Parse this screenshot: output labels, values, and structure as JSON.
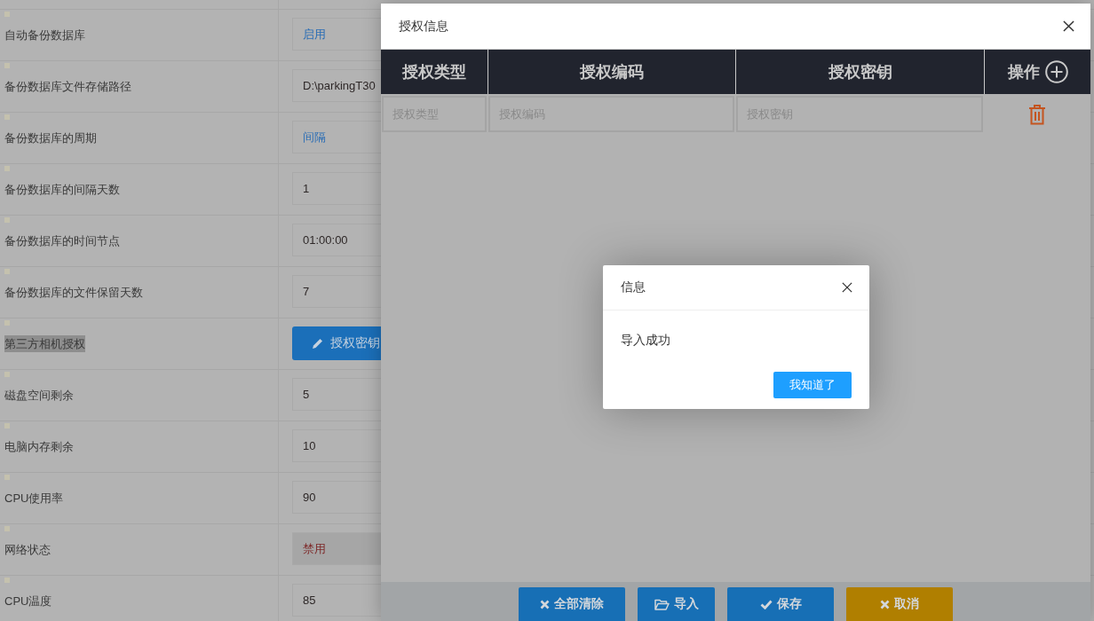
{
  "settings": [
    {
      "label": "自动备份数据库",
      "kind": "select",
      "value": "启用",
      "color": "#2a6db5",
      "highlighted": false,
      "disabled": false
    },
    {
      "label": "备份数据库文件存储路径",
      "kind": "input",
      "value": "D:\\parkingT30",
      "highlighted": false,
      "disabled": false
    },
    {
      "label": "备份数据库的周期",
      "kind": "select",
      "value": "间隔",
      "color": "#2a6db5",
      "highlighted": false,
      "disabled": false
    },
    {
      "label": "备份数据库的间隔天数",
      "kind": "input",
      "value": "1",
      "highlighted": false,
      "disabled": false
    },
    {
      "label": "备份数据库的时间节点",
      "kind": "input",
      "value": "01:00:00",
      "highlighted": false,
      "disabled": false
    },
    {
      "label": "备份数据库的文件保留天数",
      "kind": "input",
      "value": "7",
      "highlighted": false,
      "disabled": false
    },
    {
      "label": "第三方相机授权",
      "kind": "button",
      "value": "授权密钥",
      "highlighted": true,
      "disabled": false
    },
    {
      "label": "磁盘空间剩余",
      "kind": "input",
      "value": "5",
      "highlighted": false,
      "disabled": false
    },
    {
      "label": "电脑内存剩余",
      "kind": "input",
      "value": "10",
      "highlighted": false,
      "disabled": false
    },
    {
      "label": "CPU使用率",
      "kind": "input",
      "value": "90",
      "highlighted": false,
      "disabled": false
    },
    {
      "label": "网络状态",
      "kind": "select",
      "value": "禁用",
      "color": "#7e2a2a",
      "highlighted": false,
      "disabled": true
    },
    {
      "label": "CPU温度",
      "kind": "input",
      "value": "85",
      "highlighted": false,
      "disabled": false
    }
  ],
  "auth_dialog": {
    "title": "授权信息",
    "columns": [
      "授权类型",
      "授权编码",
      "授权密钥",
      "操作"
    ],
    "rows": [
      {
        "fields": [
          {
            "placeholder": "授权类型"
          },
          {
            "placeholder": "授权编码"
          },
          {
            "placeholder": "授权密钥"
          }
        ]
      }
    ],
    "buttons": [
      {
        "label": "全部清除",
        "kind": "clear"
      },
      {
        "label": "导入",
        "kind": "import"
      },
      {
        "label": "保存",
        "kind": "save"
      },
      {
        "label": "取消",
        "kind": "cancel"
      }
    ]
  },
  "message_dialog": {
    "title": "信息",
    "message": "导入成功",
    "button": "我知道了"
  }
}
